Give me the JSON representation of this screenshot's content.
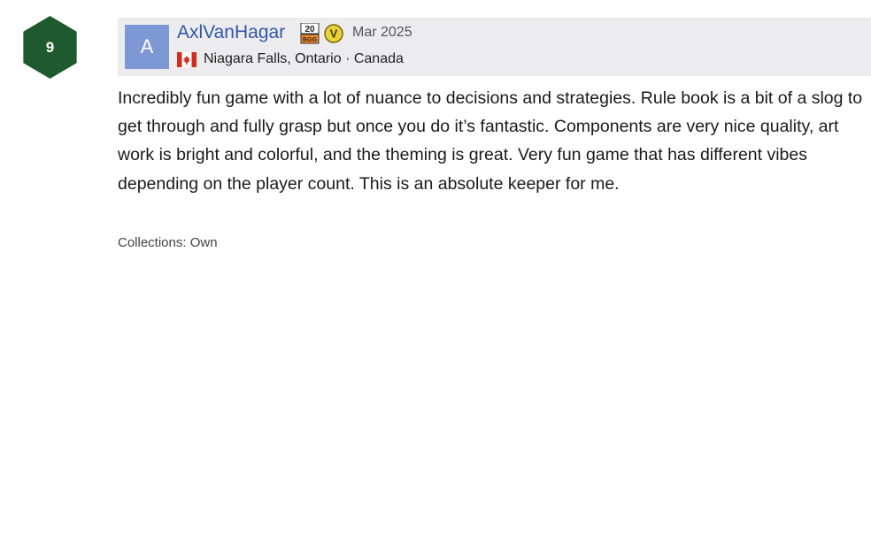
{
  "review": {
    "rating": "9",
    "avatar_initial": "A",
    "username": "AxlVanHagar",
    "date": "Mar 2025",
    "location": "Niagara Falls, Ontario · Canada",
    "text": "Incredibly fun game with a lot of nuance to decisions and strategies. Rule book is a bit of a slog to get through and fully grasp but once you do it’s fantastic. Components are very nice quality, art work is bright and colorful, and the theming is great. Very fun game that has different vibes depending on the player count. This is an absolute keeper for me.",
    "collections": "Collections: Own",
    "badges": {
      "twenty_years": "20 BGG",
      "supporter": "V"
    }
  },
  "colors": {
    "rating_bg": "#1e5a2e",
    "header_bg": "#ececee",
    "avatar_bg": "#7e98d6",
    "username": "#2f58a6"
  }
}
